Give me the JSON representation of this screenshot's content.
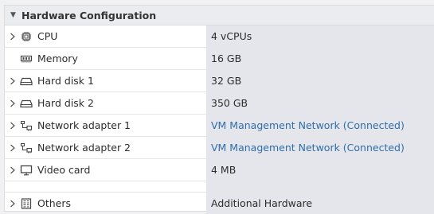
{
  "header": {
    "title": "Hardware Configuration"
  },
  "rows": [
    {
      "label": "CPU",
      "value": "4 vCPUs",
      "icon": "cpu-icon",
      "expandable": true,
      "link": false
    },
    {
      "label": "Memory",
      "value": "16 GB",
      "icon": "memory-icon",
      "expandable": false,
      "link": false
    },
    {
      "label": "Hard disk 1",
      "value": "32 GB",
      "icon": "hard-disk-icon",
      "expandable": true,
      "link": false
    },
    {
      "label": "Hard disk 2",
      "value": "350 GB",
      "icon": "hard-disk-icon",
      "expandable": true,
      "link": false
    },
    {
      "label": "Network adapter 1",
      "value": "VM Management Network (Connected)",
      "icon": "network-adapter-icon",
      "expandable": true,
      "link": true
    },
    {
      "label": "Network adapter 2",
      "value": "VM Management Network (Connected)",
      "icon": "network-adapter-icon",
      "expandable": true,
      "link": true
    },
    {
      "label": "Video card",
      "value": "4 MB",
      "icon": "monitor-icon",
      "expandable": true,
      "link": false
    },
    {
      "label": "Others",
      "value": "Additional Hardware",
      "icon": "others-icon",
      "expandable": true,
      "link": false
    }
  ],
  "colors": {
    "value_bg": "#e5e6eb",
    "link": "#2f6ea9",
    "header_bg": "#ebecef"
  }
}
